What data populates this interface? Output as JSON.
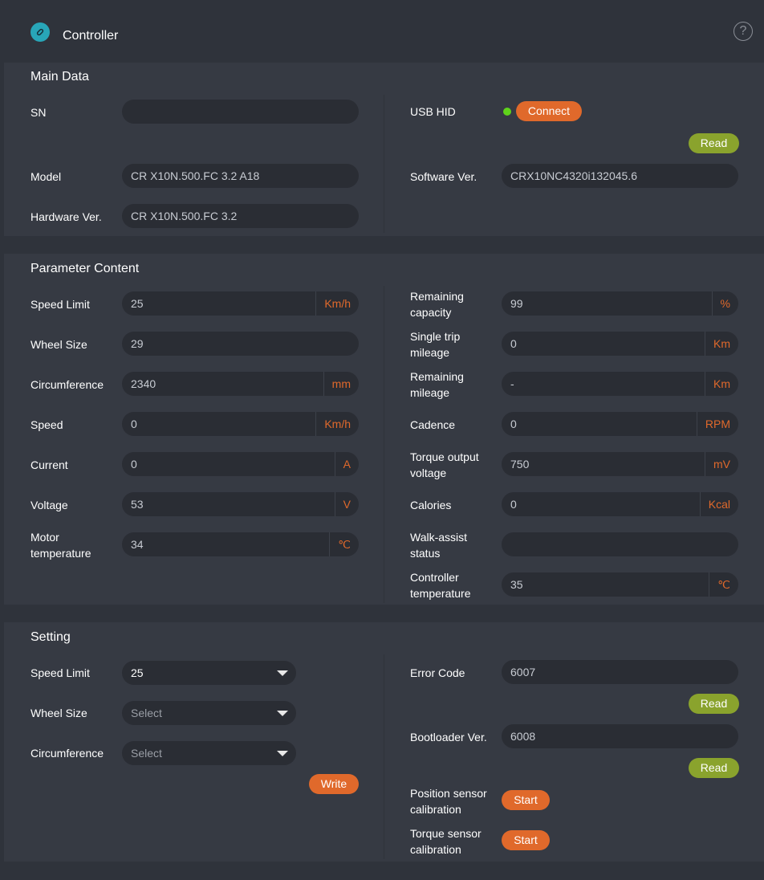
{
  "header": {
    "title": "Controller"
  },
  "main_data": {
    "title": "Main Data",
    "sn": {
      "label": "SN",
      "value": ""
    },
    "model": {
      "label": "Model",
      "value": "CR X10N.500.FC 3.2 A18"
    },
    "hardware": {
      "label": "Hardware Ver.",
      "value": "CR X10N.500.FC 3.2"
    },
    "usb": {
      "label": "USB HID",
      "status_color": "#5fd31b",
      "connect_label": "Connect"
    },
    "read_label": "Read",
    "software": {
      "label": "Software Ver.",
      "value": "CRX10NC4320i132045.6"
    }
  },
  "params": {
    "title": "Parameter Content",
    "left": [
      {
        "label": "Speed Limit",
        "value": "25",
        "unit": "Km/h"
      },
      {
        "label": "Wheel Size",
        "value": "29",
        "unit": ""
      },
      {
        "label": "Circumference",
        "value": "2340",
        "unit": "mm"
      },
      {
        "label": "Speed",
        "value": "0",
        "unit": "Km/h"
      },
      {
        "label": "Current",
        "value": "0",
        "unit": "A"
      },
      {
        "label": "Voltage",
        "value": "53",
        "unit": "V"
      },
      {
        "label": "Motor temperature",
        "value": "34",
        "unit": "℃"
      }
    ],
    "right": [
      {
        "label": "Remaining capacity",
        "value": "99",
        "unit": "%"
      },
      {
        "label": "Single trip mileage",
        "value": "0",
        "unit": "Km"
      },
      {
        "label": "Remaining mileage",
        "value": "-",
        "unit": "Km"
      },
      {
        "label": "Cadence",
        "value": "0",
        "unit": "RPM"
      },
      {
        "label": "Torque output voltage",
        "value": "750",
        "unit": "mV"
      },
      {
        "label": "Calories",
        "value": "0",
        "unit": "Kcal"
      },
      {
        "label": "Walk-assist status",
        "value": "",
        "unit": ""
      },
      {
        "label": "Controller temperature",
        "value": "35",
        "unit": "℃"
      }
    ]
  },
  "setting": {
    "title": "Setting",
    "speed_limit": {
      "label": "Speed Limit",
      "value": "25"
    },
    "wheel_size": {
      "label": "Wheel Size",
      "placeholder": "Select"
    },
    "circumference": {
      "label": "Circumference",
      "placeholder": "Select"
    },
    "write_label": "Write",
    "error_code": {
      "label": "Error Code",
      "value": "6007"
    },
    "bootloader": {
      "label": "Bootloader Ver.",
      "value": "6008"
    },
    "read_label": "Read",
    "position_cal": {
      "label_line1": "Position sensor",
      "label_line2": "calibration",
      "button": "Start"
    },
    "torque_cal": {
      "label_line1": "Torque sensor",
      "label_line2": "calibration",
      "button": "Start"
    }
  }
}
